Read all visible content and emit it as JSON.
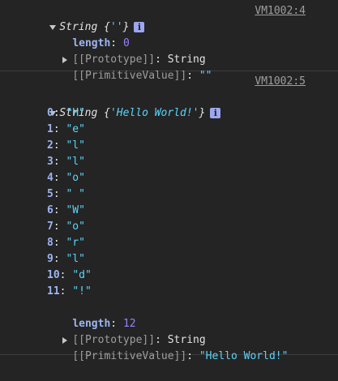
{
  "entries": [
    {
      "source": "VM1002:4",
      "type": "String",
      "preview": "''",
      "length_key": "length",
      "length_val": "0",
      "proto_key": "[[Prototype]]",
      "proto_val": "String",
      "primitive_key": "[[PrimitiveValue]]",
      "primitive_val": "\"\""
    },
    {
      "source": "VM1002:5",
      "type": "String",
      "preview": "'Hello World!'",
      "chars": [
        {
          "key": "0",
          "val": "\"H\""
        },
        {
          "key": "1",
          "val": "\"e\""
        },
        {
          "key": "2",
          "val": "\"l\""
        },
        {
          "key": "3",
          "val": "\"l\""
        },
        {
          "key": "4",
          "val": "\"o\""
        },
        {
          "key": "5",
          "val": "\" \""
        },
        {
          "key": "6",
          "val": "\"W\""
        },
        {
          "key": "7",
          "val": "\"o\""
        },
        {
          "key": "8",
          "val": "\"r\""
        },
        {
          "key": "9",
          "val": "\"l\""
        },
        {
          "key": "10",
          "val": "\"d\""
        },
        {
          "key": "11",
          "val": "\"!\""
        }
      ],
      "length_key": "length",
      "length_val": "12",
      "proto_key": "[[Prototype]]",
      "proto_val": "String",
      "primitive_key": "[[PrimitiveValue]]",
      "primitive_val": "\"Hello World!\""
    }
  ],
  "info_icon_label": "i"
}
